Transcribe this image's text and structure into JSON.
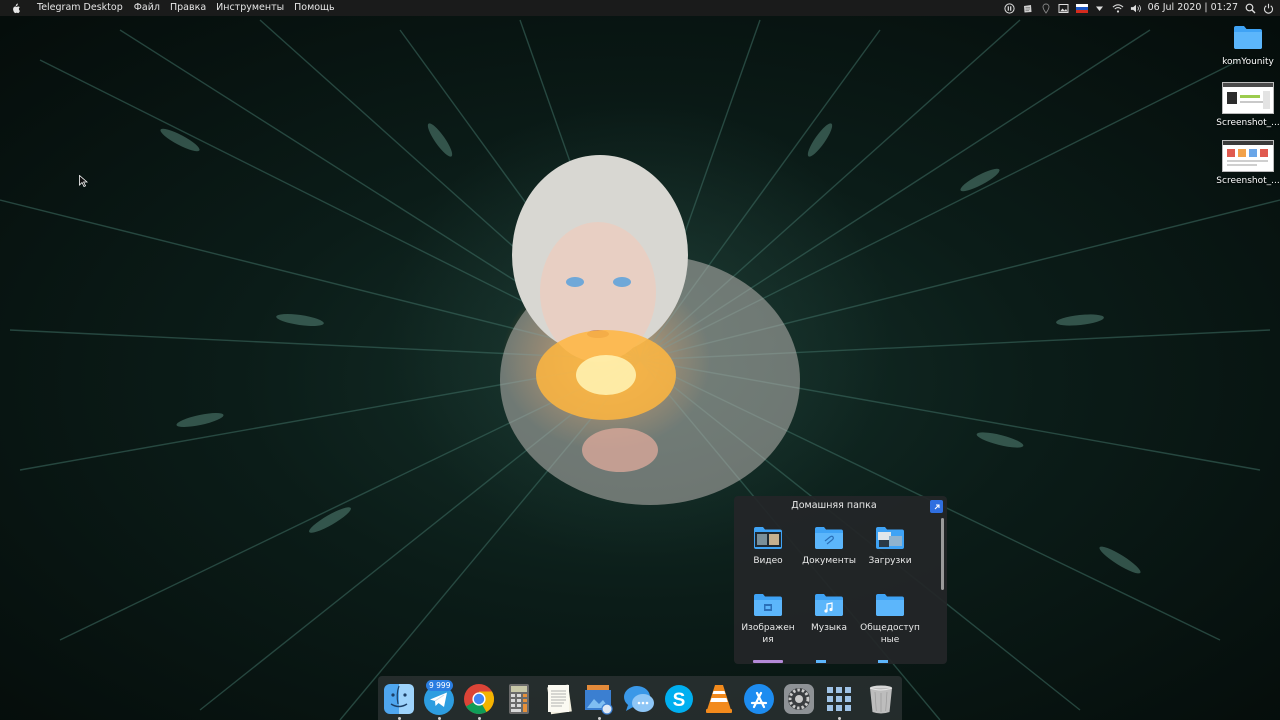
{
  "menubar": {
    "app_name": "Telegram Desktop",
    "menus": [
      "Файл",
      "Правка",
      "Инструменты",
      "Помощь"
    ],
    "clock": "06 Jul 2020 | 01:27"
  },
  "desktop": {
    "icons": [
      {
        "label": "komYounity",
        "icon": "folder-icon"
      },
      {
        "label": "Screenshot_...",
        "icon": "screenshot-thumbnail"
      },
      {
        "label": "Screenshot_...",
        "icon": "screenshot-thumbnail"
      }
    ]
  },
  "stack": {
    "title": "Домашняя папка",
    "items": [
      {
        "label": "Видео",
        "icon": "video-folder-icon"
      },
      {
        "label": "Документы",
        "icon": "documents-folder-icon"
      },
      {
        "label": "Загрузки",
        "icon": "downloads-folder-icon"
      },
      {
        "label": "Изображения",
        "icon": "pictures-folder-icon"
      },
      {
        "label": "Музыка",
        "icon": "music-folder-icon"
      },
      {
        "label": "Общедоступные",
        "icon": "public-folder-icon"
      }
    ],
    "items_display": [
      "Видео",
      "Документы",
      "Загрузки",
      "Изображен\nия",
      "Музыка",
      "Общедоступ\nные"
    ]
  },
  "dock": {
    "apps": [
      {
        "name": "finder",
        "icon": "finder-icon"
      },
      {
        "name": "telegram",
        "icon": "telegram-icon",
        "badge": "9 999"
      },
      {
        "name": "chrome",
        "icon": "chrome-icon"
      },
      {
        "name": "calculator",
        "icon": "calculator-icon"
      },
      {
        "name": "text-editor",
        "icon": "text-editor-icon"
      },
      {
        "name": "image-viewer",
        "icon": "image-viewer-icon"
      },
      {
        "name": "messages",
        "icon": "messages-icon"
      },
      {
        "name": "skype",
        "icon": "skype-icon"
      },
      {
        "name": "vlc",
        "icon": "vlc-icon"
      },
      {
        "name": "app-store",
        "icon": "app-store-icon"
      },
      {
        "name": "system-settings",
        "icon": "settings-icon"
      },
      {
        "name": "launchpad",
        "icon": "launchpad-icon"
      },
      {
        "name": "trash",
        "icon": "trash-icon"
      }
    ]
  },
  "colors": {
    "menubar_bg": "#1c1c1c",
    "folder_blue": "#3fa3f5",
    "accent": "#2f6fe0",
    "badge": "#2a7de1"
  }
}
